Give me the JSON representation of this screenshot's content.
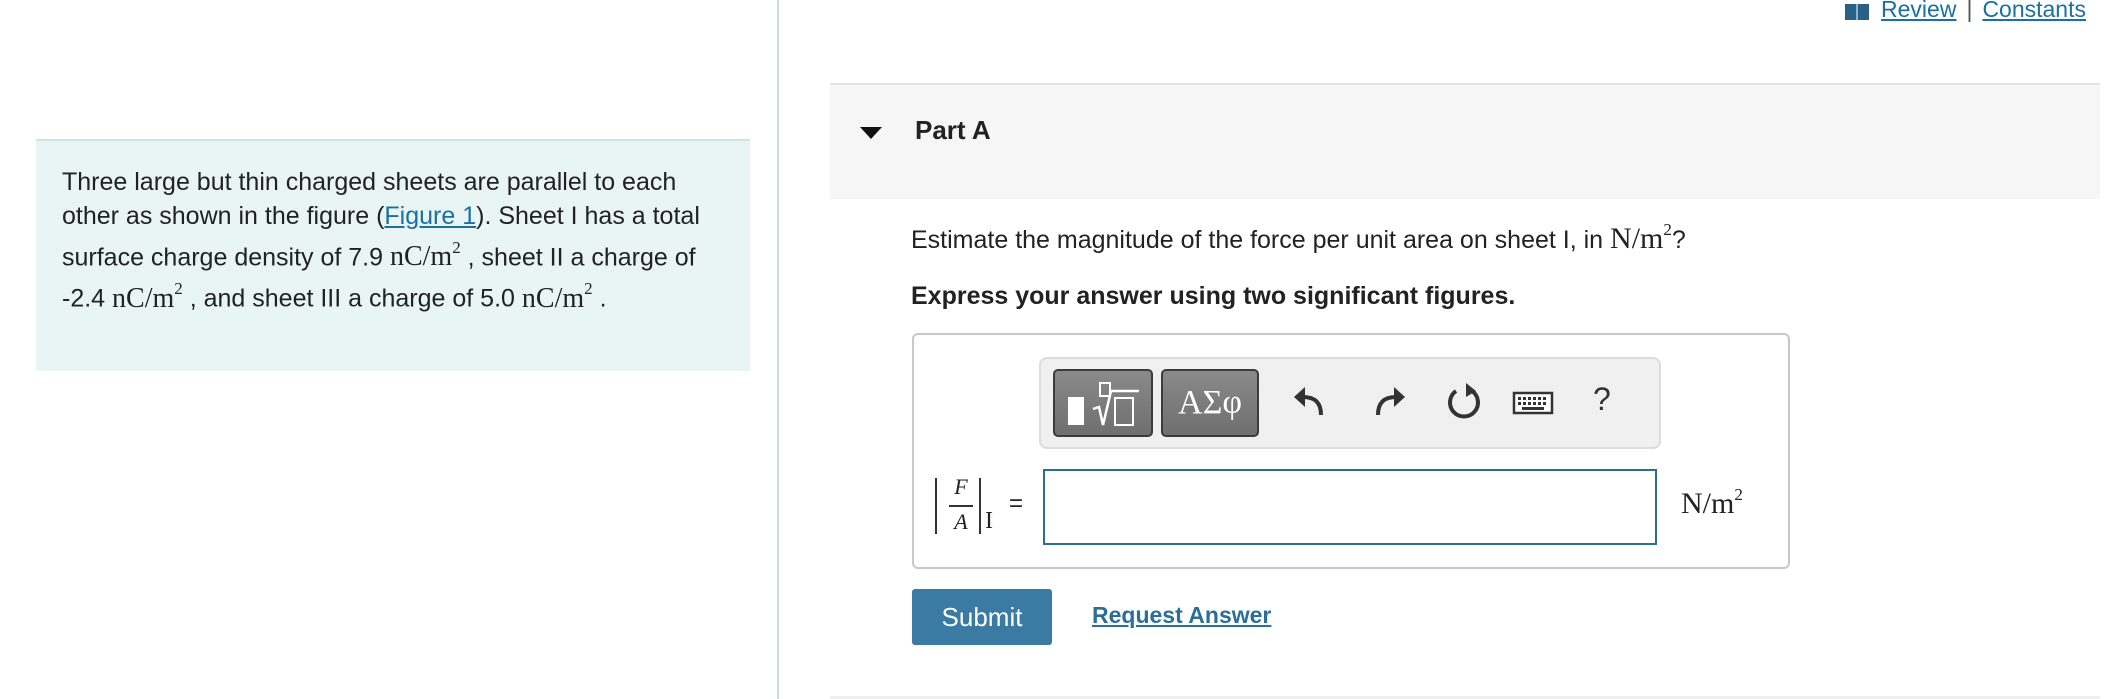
{
  "header": {
    "review_label": "Review",
    "separator": "|",
    "constants_label": "Constants",
    "icon": "book-icon"
  },
  "problem": {
    "text_1": "Three large but thin charged sheets are parallel to each other as shown in the figure (",
    "figure_link": "Figure 1",
    "text_2": "). Sheet I has a total surface charge density of 7.9 ",
    "unit_nc": "nC/m",
    "text_3": " , sheet II a charge of -2.4 ",
    "text_4": " , and sheet III a charge of 5.0 ",
    "text_5": " .",
    "exponent": "2"
  },
  "part": {
    "title": "Part A",
    "expand_icon": "caret-down-icon"
  },
  "question": {
    "text": "Estimate the magnitude of the force per unit area on sheet I, in ",
    "unit": "N/m",
    "exponent": "2",
    "suffix": "?",
    "instruction": "Express your answer using two significant figures."
  },
  "toolbar": {
    "templates_icon": "templates-icon",
    "symbols_label": "ΑΣφ",
    "undo_icon": "undo-icon",
    "redo_icon": "redo-icon",
    "reset_icon": "reset-icon",
    "keyboard_icon": "keyboard-icon",
    "help_label": "?"
  },
  "answer": {
    "lhs_numerator": "F",
    "lhs_denominator": "A",
    "lhs_subscript": "I",
    "equals": "=",
    "value": "",
    "unit": "N/m",
    "unit_exponent": "2"
  },
  "actions": {
    "submit_label": "Submit",
    "request_label": "Request Answer"
  },
  "colors": {
    "panel_bg": "#e9f5f5",
    "link": "#1a6fa3",
    "submit_bg": "#3b7ba3",
    "input_border": "#2c6e8f"
  }
}
